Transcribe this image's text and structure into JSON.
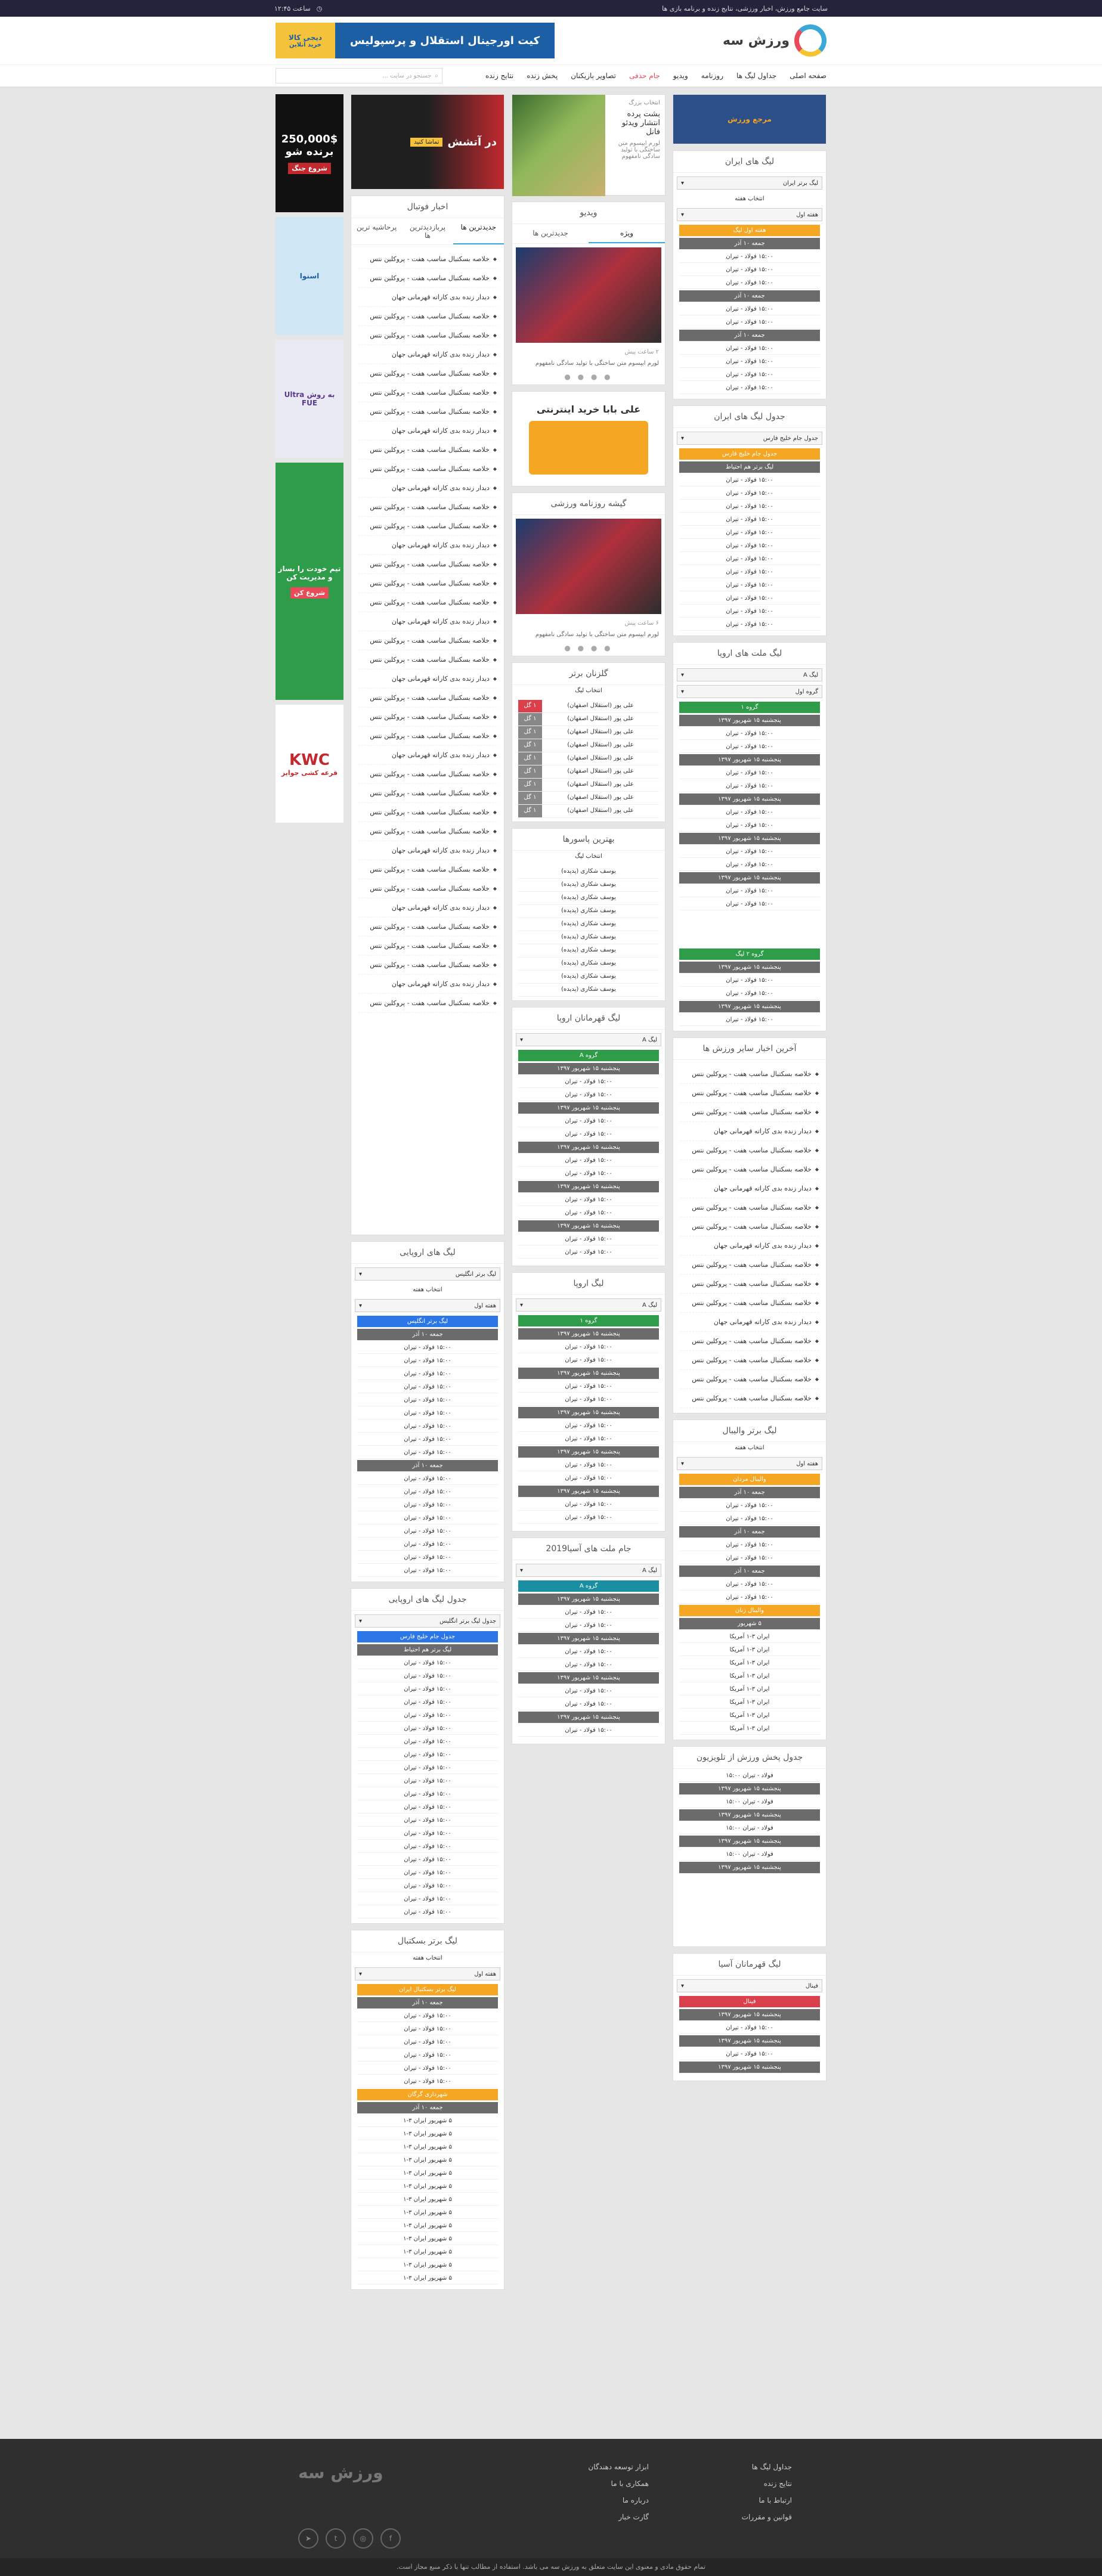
{
  "topbar": {
    "right": "سایت جامع ورزش، اخبار ورزشی، نتایج زنده و برنامه بازی ها",
    "left": "ساعت ۱۲:۴۵"
  },
  "header": {
    "logo": "ورزش سه",
    "banner_title": "کیت اورجینال استقلال و پرسپولیس",
    "banner_brand": "دیجی کالا",
    "banner_cta": "خرید آنلاین"
  },
  "nav": {
    "items": [
      "صفحه اصلی",
      "جداول لیگ ها",
      "روزنامه",
      "ویدیو",
      "جام حذفی",
      "تصاویر بازیکنان",
      "پخش زنده",
      "نتایج زنده"
    ],
    "search_placeholder": "جستجو در سایت ..."
  },
  "col1": {
    "promo": "مرجع ورزش",
    "iran_league": {
      "title": "لیگ های ایران",
      "select": "لیگ برتر ایران",
      "week": "انتخاب هفته",
      "pick": "هفته اول",
      "group": "هفته اول لیگ",
      "date": "جمعه ۱۰ آذر",
      "match": "۱۵:۰۰ فولاد - تیران"
    },
    "iran_table": {
      "title": "جدول لیگ های ایران",
      "select": "جدول جام خلیج فارس",
      "group": "جدول جام خلیج فارس",
      "sub": "لیگ برتر هم احتیاط",
      "match": "۱۵:۰۰ فولاد - تیران"
    },
    "nations": {
      "title": "لیگ ملت های اروپا",
      "select": "لیگ A",
      "pick": "گروه اول",
      "g1": "گروه ۱",
      "date": "پنجشنبه ۱۵ شهریور ۱۳۹۷",
      "match": "۱۵:۰۰ فولاد - تیران",
      "g2": "گروه ۲ لیگ"
    },
    "other_sports": {
      "title": "آخرین اخبار سایر ورزش ها",
      "item": "خلاصه بسکتبال مناسب هفت - پروکلین نتس",
      "item2": "دیدار زنده بدی کاراته قهرمانی جهان"
    },
    "volleyball": {
      "title": "لیگ برتر والیبال",
      "week": "انتخاب هفته",
      "pick": "هفته اول",
      "group": "والیبال مردان",
      "date": "جمعه ۱۰ آذر",
      "match": "۱۵:۰۰ فولاد - تیران",
      "group2": "والیبال زنان",
      "date2": "۵ شهریور",
      "match2": "ایران ۳-۱ آمریکا"
    },
    "tv": {
      "title": "جدول پخش ورزش از تلویزیون",
      "item": "فولاد - تیران ۱۵:۰۰",
      "date": "پنجشنبه ۱۵ شهریور ۱۳۹۷"
    },
    "asia": {
      "title": "لیگ قهرمانان آسیا",
      "select": "فینال",
      "group": "فینال",
      "date": "پنجشنبه ۱۵ شهریور ۱۳۹۷",
      "match": "۱۵:۰۰ فولاد - تیران"
    }
  },
  "col2": {
    "slide_cap": "انتخاب بزرگ",
    "slide_title": "بشت پرده انتشار ویدئو فانل",
    "slide_text": "لورم ایپسوم متن ساختگی با تولید سادگی نامفهوم",
    "video": {
      "title": "ویدیو",
      "tab1": "ویژه",
      "tab2": "جدیدترین ها",
      "meta": "۲ ساعت پیش",
      "text": "لورم ایپسوم متن ساختگی با تولید سادگی نامفهوم"
    },
    "ad": "علی بابا خرید اینترنتی",
    "newspaper": {
      "title": "گیشه روزنامه ورزشی",
      "meta": "۶ ساعت پیش",
      "text": "لورم ایپسوم متن ساختگی با تولید سادگی نامفهوم"
    },
    "scorers": {
      "title": "گلزنان برتر",
      "select": "انتخاب لیگ",
      "player": "علی پور (استقلال اصفهان)",
      "lab": "۱ گل"
    },
    "assists": {
      "title": "بهترین پاسورها",
      "select": "انتخاب لیگ",
      "player": "یوسف شکاری (پدیده)"
    },
    "ucl": {
      "title": "لیگ قهرمانان اروپا",
      "select": "لیگ A",
      "g": "گروه A",
      "date": "پنجشنبه ۱۵ شهریور ۱۳۹۷",
      "match": "۱۵:۰۰ فولاد - تیران"
    },
    "uel": {
      "title": "لیگ اروپا",
      "select": "لیگ A",
      "g": "گروه ۱",
      "date": "پنجشنبه ۱۵ شهریور ۱۳۹۷",
      "match": "۱۵:۰۰ فولاد - تیران"
    },
    "afc": {
      "title": "جام ملت های آسیا2019",
      "select": "لیگ A",
      "g": "گروه A",
      "date": "پنجشنبه ۱۵ شهریور ۱۳۹۷",
      "match": "۱۵:۰۰ فولاد - تیران"
    }
  },
  "col3": {
    "top_ad_title": "در آتشش",
    "top_ad_sub": "تماشا کنید",
    "news": {
      "title": "اخبار فوتبال",
      "tab1": "جدیدترین ها",
      "tab2": "پربازدیدترین ها",
      "tab3": "پرحاشیه ترین",
      "item": "خلاصه بسکتبال مناسب هفت - پروکلین نتس",
      "item2": "دیدار زنده بدی کاراته قهرمانی جهان"
    },
    "euro": {
      "title": "لیگ های اروپایی",
      "select": "لیگ برتر انگلیس",
      "week": "انتخاب هفته",
      "pick": "هفته اول",
      "g": "لیگ برتر انگلیس",
      "date": "جمعه ۱۰ آذر",
      "match": "۱۵:۰۰ فولاد - تیران"
    },
    "euro_table": {
      "title": "جدول لیگ های اروپایی",
      "select": "جدول لیگ برتر انگلیس",
      "g": "جدول جام خلیج فارس",
      "sub": "لیگ برتر هم احتیاط",
      "match": "۱۵:۰۰ فولاد - تیران"
    },
    "basket": {
      "title": "لیگ برتر بسکتبال",
      "week": "انتخاب هفته",
      "pick": "هفته اول",
      "g": "لیگ برتر بسکتبال ایران",
      "date": "جمعه ۱۰ آذر",
      "match": "۱۵:۰۰ فولاد - تیران",
      "g2": "شهرداری گرگان",
      "match2": "۵ شهریور ایران ۳-۱"
    }
  },
  "ads": {
    "a1": "250,000$ برنده شو",
    "a1b": "شروع جنگ",
    "a2": "اسنوا",
    "a3": "به روش Ultra FUE",
    "a4": "تیم خودت را بساز و مدیریت کن",
    "a4b": "شروع کن",
    "a5": "KWC",
    "a5b": "قرعه کشی جوایز"
  },
  "footer": {
    "links": [
      "جداول لیگ ها",
      "ابزار توسعه دهندگان",
      "نتایج زنده",
      "همکاری با ما",
      "ارتباط با ما",
      "درباره ما",
      "قوانین و مقررات",
      "گارت خبار"
    ],
    "logo": "ورزش سه",
    "copy": "تمام حقوق مادی و معنوی این سایت متعلق به ورزش سه می باشد. استفاده از مطالب تنها با ذکر منبع مجاز است."
  }
}
